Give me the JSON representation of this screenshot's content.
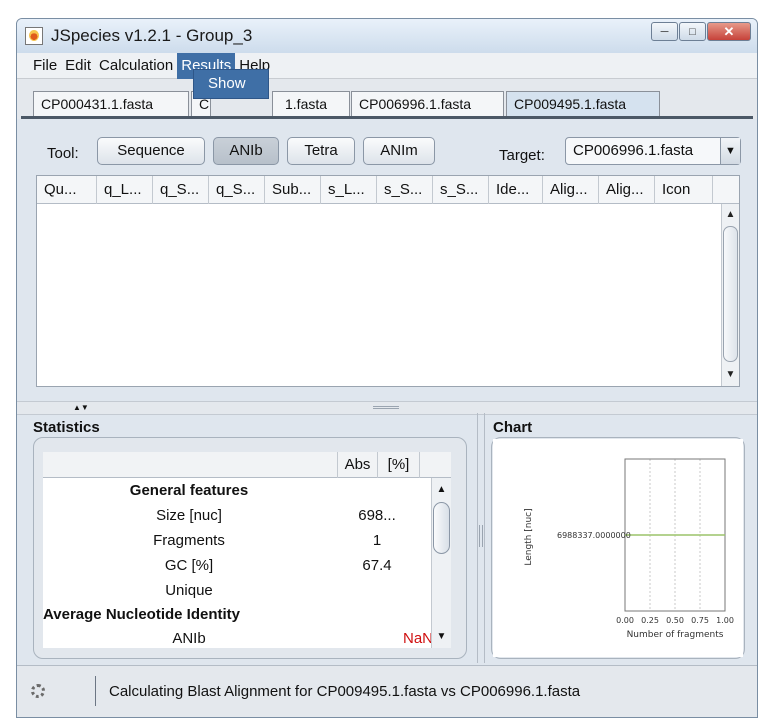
{
  "window": {
    "title": "JSpecies v1.2.1 - Group_3"
  },
  "menubar": {
    "items": [
      "File",
      "Edit",
      "Calculation",
      "Results",
      "Help"
    ],
    "active": "Results"
  },
  "dropdown": {
    "items": [
      "Show"
    ]
  },
  "file_tabs": [
    "CP000431.1.fasta",
    "C",
    "1.fasta",
    "CP006996.1.fasta",
    "CP009495.1.fasta"
  ],
  "toolbar": {
    "tool_label": "Tool:",
    "buttons": [
      "Sequence",
      "ANIb",
      "Tetra",
      "ANIm"
    ],
    "selected_tool": "ANIb",
    "target_label": "Target:",
    "target_value": "CP006996.1.fasta"
  },
  "results_table": {
    "columns": [
      "Qu...",
      "q_L...",
      "q_S...",
      "q_S...",
      "Sub...",
      "s_L...",
      "s_S...",
      "s_S...",
      "Ide...",
      "Alig...",
      "Alig...",
      "Icon"
    ],
    "rows": []
  },
  "statistics": {
    "title": "Statistics",
    "columns": [
      "Abs",
      "[%]"
    ],
    "rows": [
      {
        "label": "General features",
        "abs": "",
        "pct": ""
      },
      {
        "label": "Size [nuc]",
        "abs": "698...",
        "pct": ""
      },
      {
        "label": "Fragments",
        "abs": "1",
        "pct": ""
      },
      {
        "label": "GC [%]",
        "abs": "67.4",
        "pct": ""
      },
      {
        "label": "Unique",
        "abs": "",
        "pct": ""
      },
      {
        "label": "Average Nucleotide Identity",
        "abs": "",
        "pct": ""
      },
      {
        "label": "ANIb",
        "abs": "NaN",
        "pct": ""
      }
    ]
  },
  "chart": {
    "title": "Chart"
  },
  "chart_data": {
    "type": "line",
    "title": "",
    "xlabel": "Number of fragments",
    "ylabel": "Length [nuc]",
    "x_ticks": [
      "0.00",
      "0.25",
      "0.50",
      "0.75",
      "1.00"
    ],
    "xlim": [
      0,
      1
    ],
    "series": [
      {
        "x": [
          0,
          1
        ],
        "y": [
          6988337.0,
          6988337.0
        ]
      }
    ],
    "y_tick_label": "6988337.0000000",
    "series_color": "#9cc46a",
    "grid": true
  },
  "status": {
    "text": "Calculating Blast Alignment for  CP009495.1.fasta vs CP006996.1.fasta"
  }
}
